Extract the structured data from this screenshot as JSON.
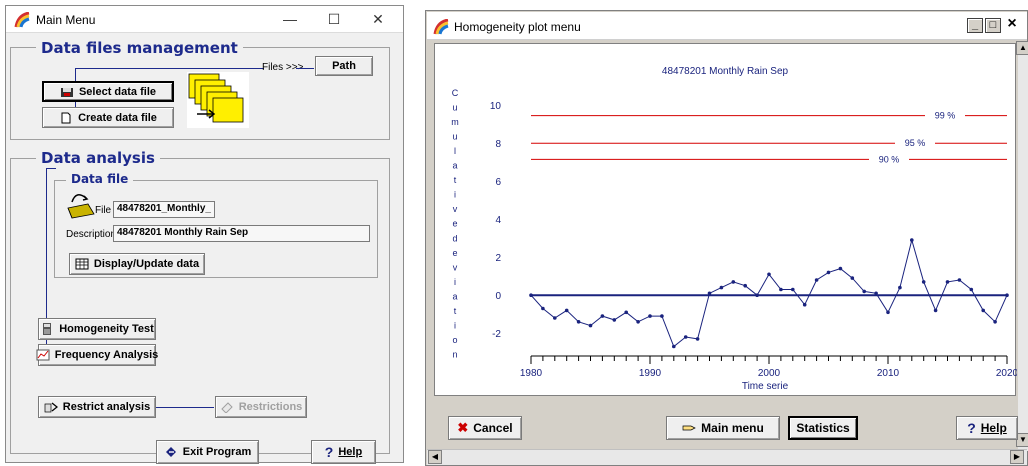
{
  "main_menu": {
    "title": "Main Menu",
    "data_files_group": "Data files management",
    "files_label": "Files >>>",
    "path_button": "Path",
    "select_button": "Select data file",
    "create_button": "Create data file",
    "analysis_group": "Data analysis",
    "data_file_group": "Data file",
    "file_label": "File",
    "file_value": "48478201_Monthly_",
    "description_label": "Description",
    "description_value": "48478201 Monthly Rain Sep",
    "display_button": "Display/Update data",
    "homogeneity_button": "Homogeneity Test",
    "frequency_button": "Frequency Analysis",
    "restrict_button": "Restrict analysis",
    "restrictions_button": "Restrictions",
    "exit_button": "Exit Program",
    "help_button": "Help",
    "help_glyph": "?",
    "caption_minimize": "—",
    "caption_maximize": "☐",
    "caption_close": "✕"
  },
  "homogeneity_window": {
    "title": "Homogeneity plot menu",
    "caption_minimize": "_",
    "caption_maximize": "□",
    "caption_close": "×",
    "cancel_button": "Cancel",
    "cancel_glyph": "✖",
    "main_menu_button": "Main menu",
    "statistics_button": "Statistics",
    "help_button": "Help",
    "help_glyph": "?"
  },
  "chart_data": {
    "type": "line",
    "title": "48478201 Monthly Rain Sep",
    "xlabel": "Time serie",
    "ylabel": "Cumulative deviation",
    "xlim": [
      1980,
      2020
    ],
    "ylim": [
      -3.2,
      10.8
    ],
    "x_ticks": [
      1980,
      1990,
      2000,
      2010,
      2020
    ],
    "y_ticks": [
      -2,
      0,
      2,
      4,
      6,
      8,
      10
    ],
    "threshold_lines": [
      {
        "label": "99 %",
        "value": 9.45
      },
      {
        "label": "95 %",
        "value": 8.0
      },
      {
        "label": "90 %",
        "value": 7.15
      }
    ],
    "colors": {
      "series": "#1a237e",
      "threshold": "#d50000",
      "zero_line": "#1a237e"
    },
    "series": [
      {
        "x": [
          1980,
          1981,
          1982,
          1983,
          1984,
          1985,
          1986,
          1987,
          1988,
          1989,
          1990,
          1991,
          1992,
          1993,
          1994,
          1995,
          1996,
          1997,
          1998,
          1999,
          2000,
          2001,
          2002,
          2003,
          2004,
          2005,
          2006,
          2007,
          2008,
          2009,
          2010,
          2011,
          2012,
          2013,
          2014,
          2015,
          2016,
          2017,
          2018,
          2019,
          2020
        ],
        "values": [
          0,
          -0.7,
          -1.2,
          -0.8,
          -1.4,
          -1.6,
          -1.1,
          -1.3,
          -0.9,
          -1.4,
          -1.1,
          -1.1,
          -2.7,
          -2.2,
          -2.3,
          0.1,
          0.4,
          0.7,
          0.5,
          0.0,
          1.1,
          0.3,
          0.3,
          -0.5,
          0.8,
          1.2,
          1.4,
          0.9,
          0.2,
          0.1,
          -0.9,
          0.4,
          2.9,
          0.7,
          -0.8,
          0.7,
          0.8,
          0.3,
          -0.8,
          -1.4,
          0.0
        ]
      }
    ]
  }
}
